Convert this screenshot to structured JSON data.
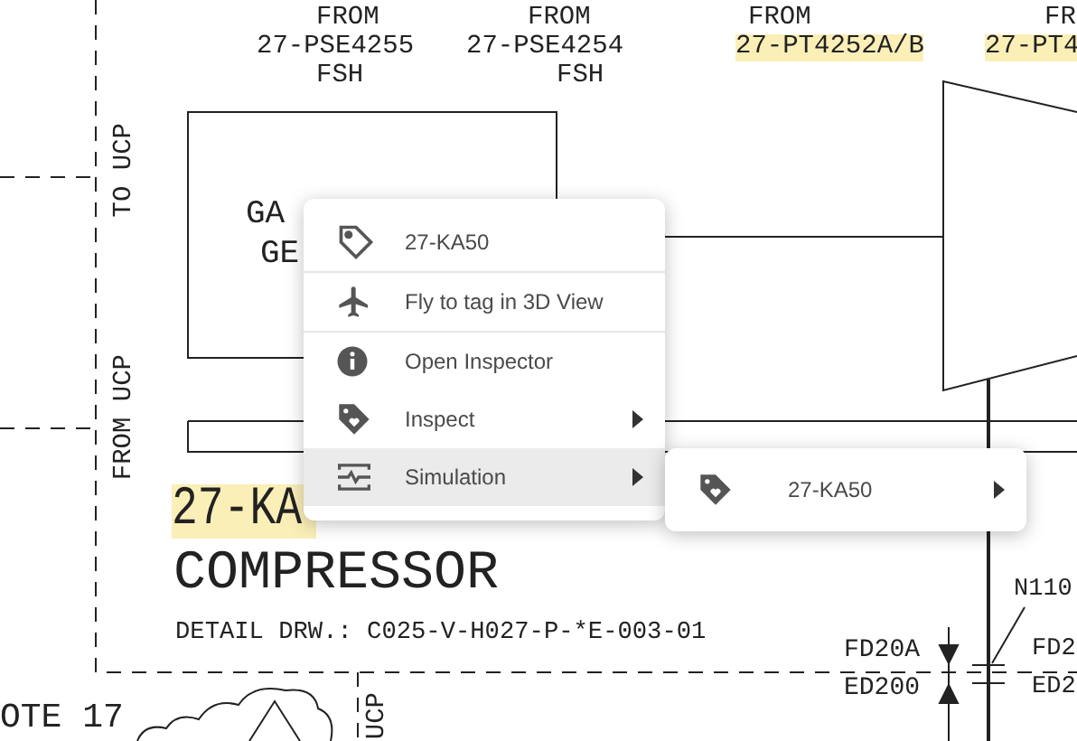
{
  "drawing": {
    "labels": [
      {
        "text": "FROM",
        "highlighted": false
      },
      {
        "text": "27-PSE4255",
        "highlighted": false
      },
      {
        "text": "FSH",
        "highlighted": false
      },
      {
        "text": "FROM",
        "highlighted": false
      },
      {
        "text": "27-PSE4254",
        "highlighted": false
      },
      {
        "text": "FSH",
        "highlighted": false
      },
      {
        "text": "FROM",
        "highlighted": false
      },
      {
        "text": "27-PT4252A/B",
        "highlighted": true
      },
      {
        "text": "FR",
        "highlighted": false
      },
      {
        "text": "27-PT4",
        "highlighted": true
      },
      {
        "text": "GA",
        "highlighted": false
      },
      {
        "text": "GE",
        "highlighted": false
      },
      {
        "text": "27-KA",
        "highlighted": true
      },
      {
        "text": "COMPRESSOR",
        "highlighted": false
      },
      {
        "text": "DETAIL DRW.: C025-V-H027-P-*E-003-01",
        "highlighted": false
      },
      {
        "text": "OTE 17",
        "highlighted": false
      },
      {
        "text": "FD20A",
        "highlighted": false
      },
      {
        "text": "ED200",
        "highlighted": false
      },
      {
        "text": "N110",
        "highlighted": false
      },
      {
        "text": "FD2",
        "highlighted": false
      },
      {
        "text": "ED2",
        "highlighted": false
      },
      {
        "text": "TO UCP",
        "highlighted": false
      },
      {
        "text": "FROM UCP",
        "highlighted": false
      },
      {
        "text": "UCP",
        "highlighted": false
      }
    ]
  },
  "context_menu": {
    "items": [
      {
        "label": "27-KA50",
        "has_submenu": false,
        "selected": false
      },
      {
        "label": "Fly to tag in 3D View",
        "has_submenu": false,
        "selected": false
      },
      {
        "label": "Open Inspector",
        "has_submenu": false,
        "selected": false
      },
      {
        "label": "Inspect",
        "has_submenu": true,
        "selected": false
      },
      {
        "label": "Simulation",
        "has_submenu": true,
        "selected": true
      }
    ]
  },
  "submenu": {
    "items": [
      {
        "label": "27-KA50",
        "has_submenu": true,
        "selected": false
      }
    ]
  }
}
